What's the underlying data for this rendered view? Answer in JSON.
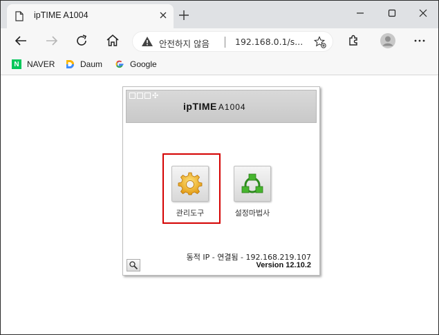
{
  "browser": {
    "tab": {
      "title": "ipTIME A1004"
    },
    "address_bar": {
      "security_text": "안전하지 않음",
      "url": "192.168.0.1/s..."
    },
    "bookmarks": [
      {
        "label": "NAVER",
        "icon": "naver-icon",
        "color": "#03c75a"
      },
      {
        "label": "Daum",
        "icon": "daum-icon"
      },
      {
        "label": "Google",
        "icon": "google-icon"
      }
    ]
  },
  "router_page": {
    "brand": {
      "name": "ipTIME",
      "model": "A1004"
    },
    "tools": [
      {
        "label": "관리도구",
        "icon": "gear-icon",
        "selected": true
      },
      {
        "label": "설정마법사",
        "icon": "network-icon"
      }
    ],
    "status": "동적 IP - 연결됨 - 192.168.219.107",
    "version": "Version 12.10.2",
    "highlight_color": "#d40000"
  }
}
